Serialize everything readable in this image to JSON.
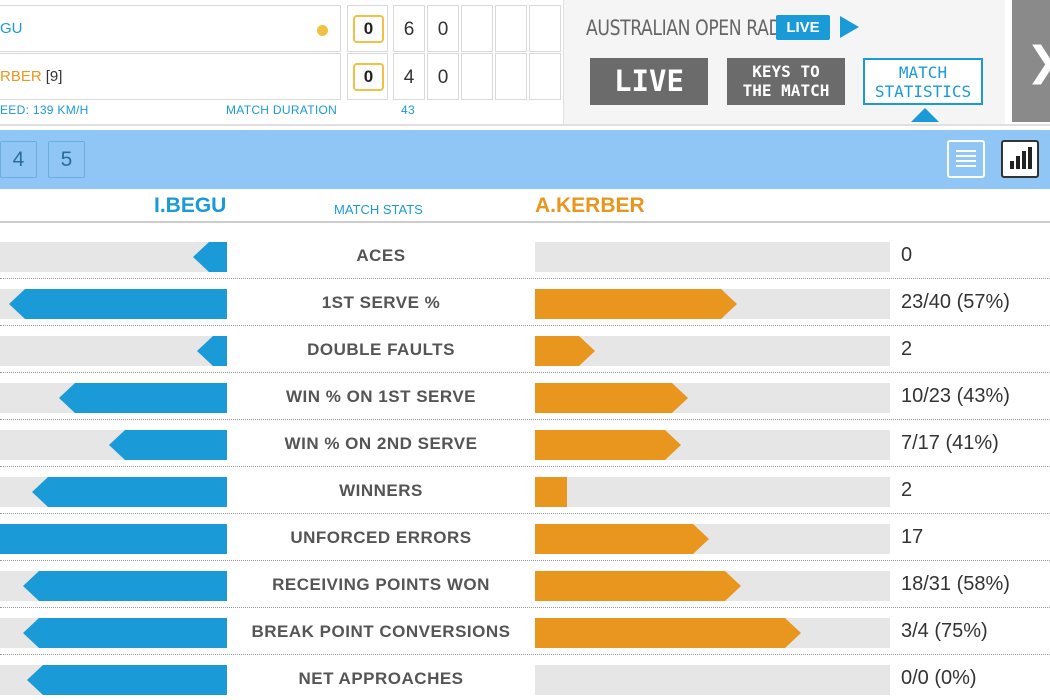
{
  "scoreboard": {
    "player1": {
      "name_visible": "GU",
      "serving": true
    },
    "player2": {
      "name_visible": "RBER",
      "seed": "[9]"
    },
    "sets": {
      "player1": {
        "games_current": "0",
        "set1": "6",
        "set2": "0"
      },
      "player2": {
        "games_current": "0",
        "set1": "4",
        "set2": "0"
      }
    },
    "serve_speed_label": "EED: 139 KM/H",
    "duration_label": "MATCH DURATION",
    "duration_value": "43"
  },
  "radio": {
    "title": "AUSTRALIAN OPEN RADIO",
    "live_badge": "LIVE",
    "play_icon": "play-icon"
  },
  "nav": {
    "live_label": "LIVE",
    "keys_line1": "KEYS TO",
    "keys_line2": "THE MATCH",
    "stats_line1": "MATCH",
    "stats_line2": "STATISTICS",
    "next_icon": "chevron-right-icon"
  },
  "toolbar": {
    "set_tabs": [
      "4",
      "5"
    ],
    "list_view_icon": "list-icon",
    "chart_view_icon": "bar-chart-icon"
  },
  "stats_header": {
    "player1": "I.BEGU",
    "middle": "MATCH STATS",
    "player2": "A.KERBER"
  },
  "colors": {
    "player1": "#1a9ad6",
    "player2": "#e8961e",
    "toolbar": "#8fc6f5"
  },
  "stats": [
    {
      "label": "ACES",
      "p1_fill": 0.15,
      "p2_fill": 0.0,
      "p2_value": "0"
    },
    {
      "label": "1ST SERVE %",
      "p1_fill": 0.96,
      "p2_fill": 0.57,
      "p2_value": "23/40 (57%)"
    },
    {
      "label": "DOUBLE FAULTS",
      "p1_fill": 0.13,
      "p2_fill": 0.17,
      "p2_value": "2"
    },
    {
      "label": "WIN % ON 1ST SERVE",
      "p1_fill": 0.74,
      "p2_fill": 0.43,
      "p2_value": "10/23 (43%)"
    },
    {
      "label": "WIN % ON 2ND SERVE",
      "p1_fill": 0.52,
      "p2_fill": 0.41,
      "p2_value": "7/17 (41%)"
    },
    {
      "label": "WINNERS",
      "p1_fill": 0.86,
      "p2_fill": 0.09,
      "p2_value": "2"
    },
    {
      "label": "UNFORCED ERRORS",
      "p1_fill": 1.0,
      "p2_fill": 0.49,
      "p2_value": "17"
    },
    {
      "label": "RECEIVING POINTS WON",
      "p1_fill": 0.9,
      "p2_fill": 0.58,
      "p2_value": "18/31 (58%)"
    },
    {
      "label": "BREAK POINT CONVERSIONS",
      "p1_fill": 0.9,
      "p2_fill": 0.75,
      "p2_value": "3/4 (75%)"
    },
    {
      "label": "NET APPROACHES",
      "p1_fill": 0.88,
      "p2_fill": 0.0,
      "p2_value": "0/0 (0%)"
    }
  ]
}
